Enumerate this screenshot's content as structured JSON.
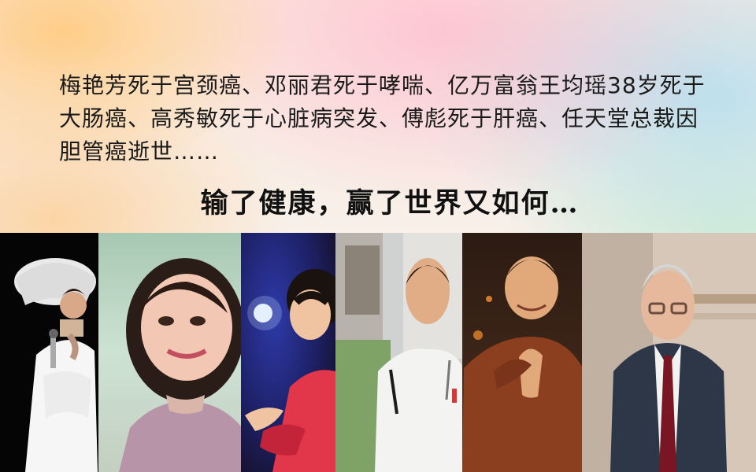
{
  "slide": {
    "paragraph": "梅艳芳死于宫颈癌、邓丽君死于哮喘、亿万富翁王均瑶38岁死于大肠癌、高秀敏死于心脏病突发、傅彪死于肝癌、任天堂总裁因胆管癌逝世……",
    "headline": "输了健康，赢了世界又如何…"
  },
  "photos": [
    {
      "name": "photo-1"
    },
    {
      "name": "photo-2"
    },
    {
      "name": "photo-3"
    },
    {
      "name": "photo-4"
    },
    {
      "name": "photo-5"
    },
    {
      "name": "photo-6"
    }
  ],
  "colors": {
    "text": "#1a1a1a",
    "headline": "#111111"
  }
}
